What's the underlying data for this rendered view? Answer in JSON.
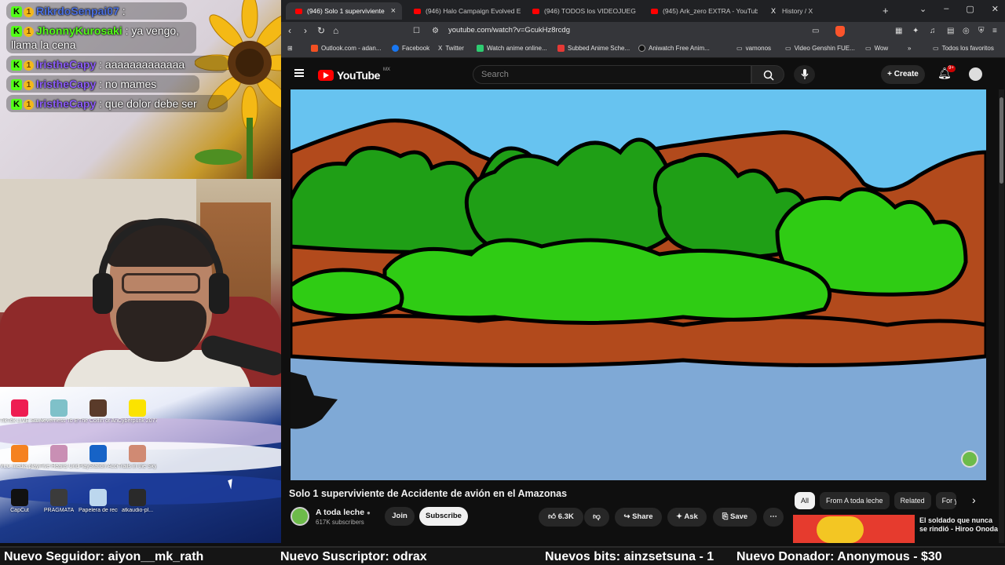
{
  "chat": [
    {
      "user": "RikrdoSenpai07",
      "text": ":",
      "user_color": "blue"
    },
    {
      "user": "JhonnyKurosaki",
      "text": ": ya vengo, llama la cena",
      "user_color": "green"
    },
    {
      "user": "IristheCapy",
      "text": ": aaaaaaaaaaaaa",
      "user_color": "purple"
    },
    {
      "user": "IristheCapy",
      "text": ": no mames",
      "user_color": "purple"
    },
    {
      "user": "IristheCapy",
      "text": ": que dolor debe ser",
      "user_color": "purple"
    }
  ],
  "desktop_icons": [
    "TikTok LIVE Studio",
    "Neverness To Everness",
    "The Coffin of Andy and L...",
    "Cyberpunk 2077",
    "VLC media player",
    "Five Hearts Under O...",
    "PlayStation Accessories",
    "Trails in the Sky 1st C...",
    "CapCut",
    "PRAGMATA",
    "Papelera de reciclaje",
    "atkaudio-pl..."
  ],
  "browser": {
    "tabs": [
      {
        "title": "(946) Solo 1 superviviente",
        "active": true,
        "icon": "youtube-icon"
      },
      {
        "title": "(946) Halo Campaign Evolved Es",
        "active": false,
        "icon": "youtube-icon"
      },
      {
        "title": "(946) TODOS los VIDEOJUEG",
        "active": false,
        "icon": "youtube-icon"
      },
      {
        "title": "(945) Ark_zero EXTRA - YouTube",
        "active": false,
        "icon": "youtube-icon"
      },
      {
        "title": "History / X",
        "active": false,
        "icon": "x-icon"
      }
    ],
    "url": "youtube.com/watch?v=GcukHz8rcdg",
    "bookmarks": [
      "Outlook.com - adan...",
      "Facebook",
      "Twitter",
      "Watch anime online...",
      "Subbed Anime Sche...",
      "Aniwatch Free Anim...",
      "vamonos",
      "Video Genshin FUE...",
      "Wow",
      "»",
      "Todos los favoritos"
    ],
    "colors": {
      "accent": "#ff0000",
      "bg": "#0f0f0f"
    }
  },
  "youtube": {
    "logo": "YouTube",
    "region": "MX",
    "search_placeholder": "Search",
    "create_label": "Create",
    "notifications": "9+",
    "video_title": "Solo 1 superviviente de Accidente de avión en el Amazonas",
    "channel": {
      "name": "A toda leche",
      "subscribers": "617K subscribers"
    },
    "join_label": "Join",
    "subscribe_label": "Subscribe",
    "likes": "6.3K",
    "share_label": "Share",
    "ask_label": "Ask",
    "save_label": "Save",
    "chips": [
      "All",
      "From A toda leche",
      "Related",
      "For y"
    ],
    "recommended_title": "El soldado que nunca se rindió - Hiroo Onoda"
  },
  "ticker": [
    "Nuevo Seguidor: aiyon__mk_rath",
    "Nuevo Suscriptor: odrax",
    "Nuevos bits: ainzsetsuna - 1",
    "Nuevo Donador: Anonymous - $30"
  ]
}
